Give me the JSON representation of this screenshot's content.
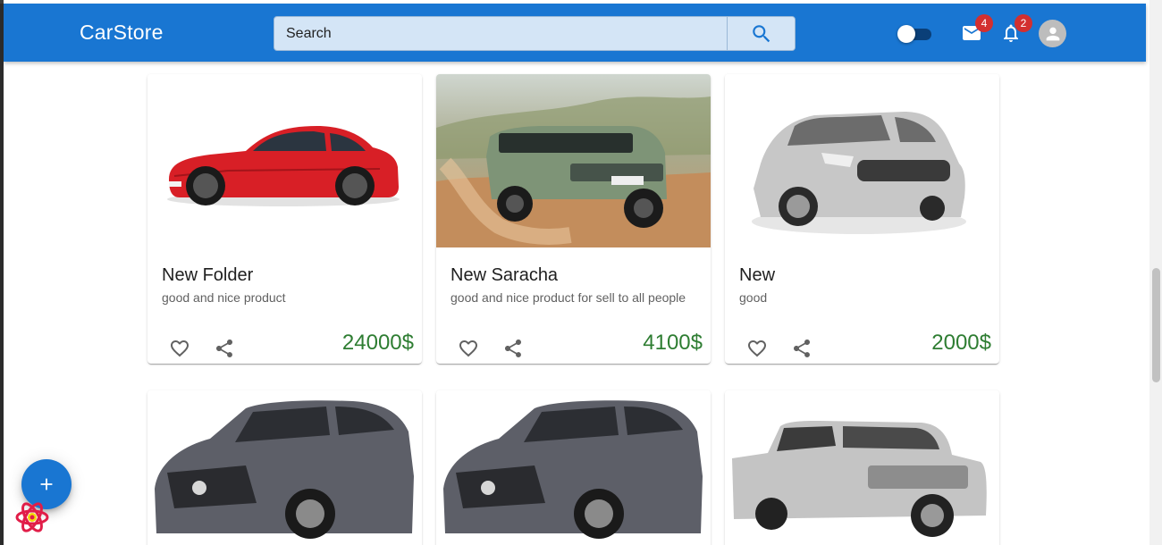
{
  "app": {
    "title": "CarStore"
  },
  "search": {
    "placeholder": "Search",
    "value": ""
  },
  "header": {
    "mail_badge": "4",
    "notifications_badge": "2",
    "theme_toggle": "off"
  },
  "colors": {
    "primary": "#1976d2",
    "price": "#2e7d32",
    "badge": "#d32f2f"
  },
  "products": [
    {
      "title": "New Folder",
      "description": "good and nice product",
      "price": "24000$",
      "image": "red-coupe-car-photo"
    },
    {
      "title": "New Saracha",
      "description": "good and nice product for sell to all people",
      "price": "4100$",
      "image": "green-suv-desert-photo"
    },
    {
      "title": "New",
      "description": "good",
      "price": "2000$",
      "image": "silver-hatchback-photo"
    },
    {
      "image": "gray-suv-photo"
    },
    {
      "image": "gray-suv-photo"
    },
    {
      "image": "silver-pickup-truck-photo"
    }
  ],
  "icons": {
    "search": "search-icon",
    "mail": "mail-icon",
    "bell": "notifications-icon",
    "avatar": "account-icon",
    "like": "favorite-border-icon",
    "share": "share-icon",
    "add": "add-icon",
    "devtools": "react-devtools-icon"
  }
}
